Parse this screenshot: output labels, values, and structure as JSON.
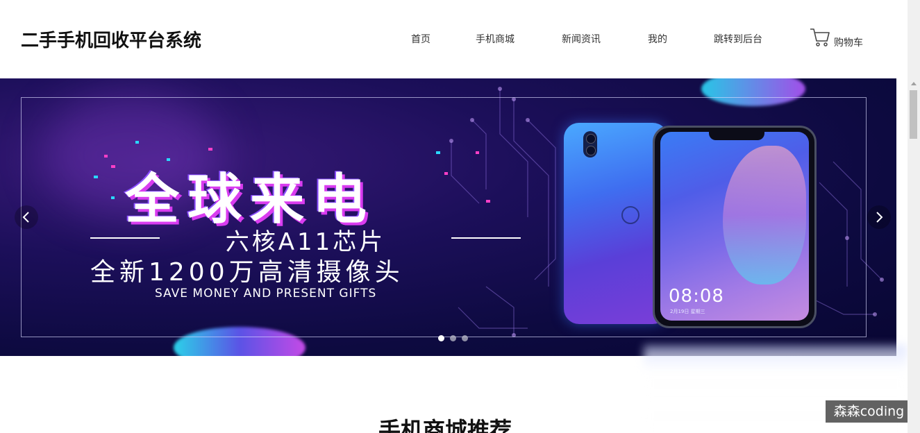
{
  "header": {
    "site_title": "二手手机回收平台系统",
    "nav": [
      {
        "label": "首页"
      },
      {
        "label": "手机商城"
      },
      {
        "label": "新闻资讯"
      },
      {
        "label": "我的"
      },
      {
        "label": "跳转到后台"
      }
    ],
    "cart": {
      "label": "购物车",
      "icon": "cart-icon"
    }
  },
  "banner": {
    "headline": "全球来电",
    "subline1": "六核A11芯片",
    "subline2": "全新1200万高清摄像头",
    "subline3": "SAVE MONEY AND PRESENT GIFTS",
    "phone_time": "08:08",
    "phone_date": "2月19日 星期三",
    "slide_count": 3,
    "active_slide": 1,
    "prev_icon": "chevron-left-icon",
    "next_icon": "chevron-right-icon"
  },
  "section": {
    "title": "手机商城推荐"
  },
  "watermark": "森森coding",
  "colors": {
    "accent_pink": "#d93cf0",
    "banner_bg": "#0d0a40"
  }
}
